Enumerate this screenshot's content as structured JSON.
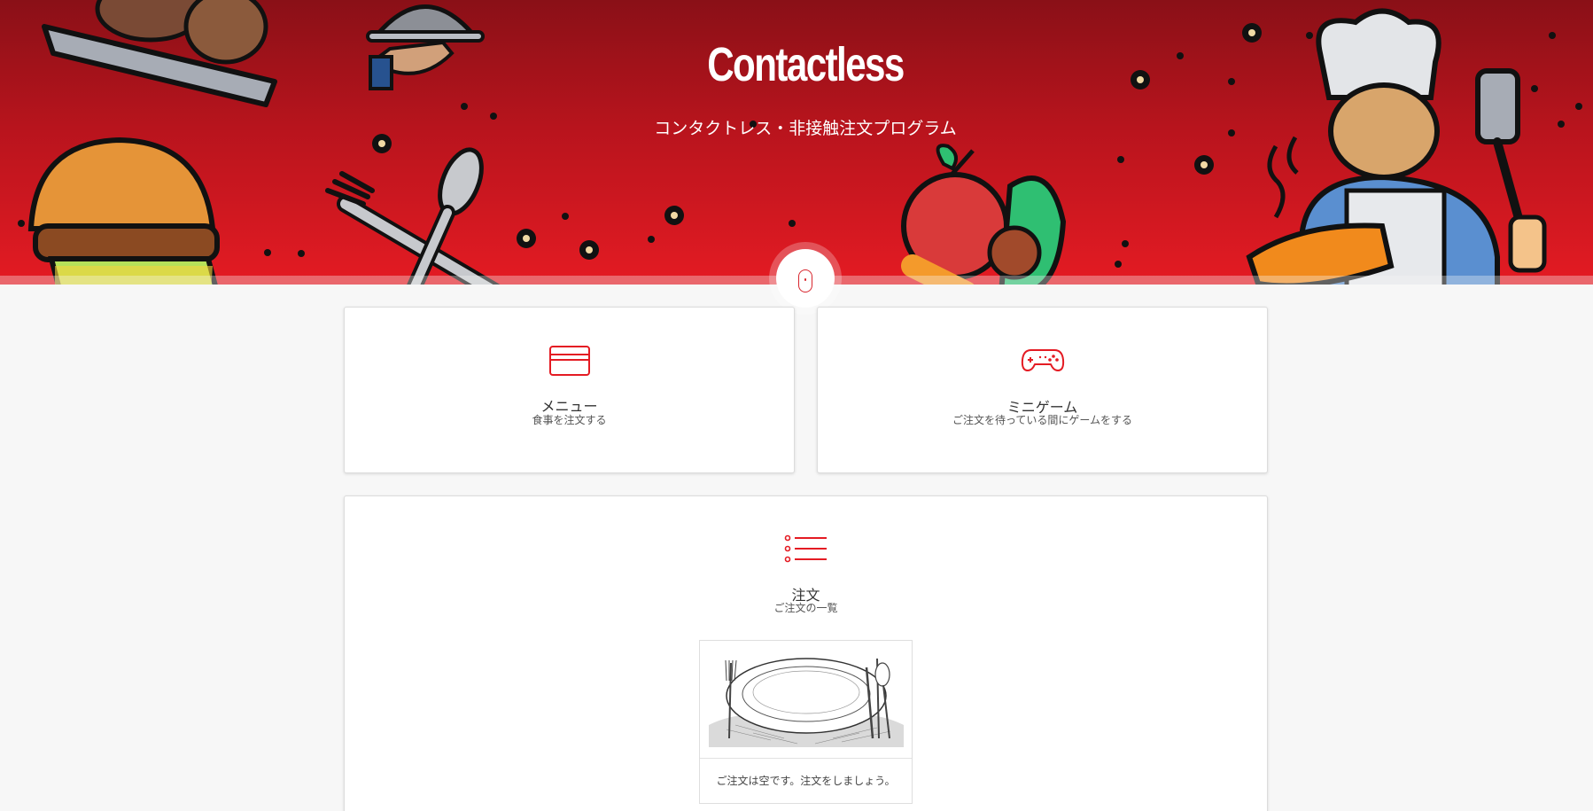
{
  "app": {
    "title": "Contactless",
    "subtitle": "コンタクトレス・非接触注文プログラム"
  },
  "theme": {
    "accent": "#e41b23",
    "accent_dark": "#8a1017",
    "background": "#f7f7f7"
  },
  "hero": {
    "scroll_icon": "mouse-scroll-icon"
  },
  "cards": {
    "menu": {
      "icon": "credit-card-icon",
      "title": "メニュー",
      "description": "食事を注文する"
    },
    "game": {
      "icon": "gamepad-icon",
      "title": "ミニゲーム",
      "description": "ご注文を待っている間にゲームをする"
    },
    "orders": {
      "icon": "list-icon",
      "title": "注文",
      "description": "ご注文の一覧",
      "empty_image": "empty-plate-illustration",
      "empty_message": "ご注文は空です。注文をしましょう。"
    }
  }
}
